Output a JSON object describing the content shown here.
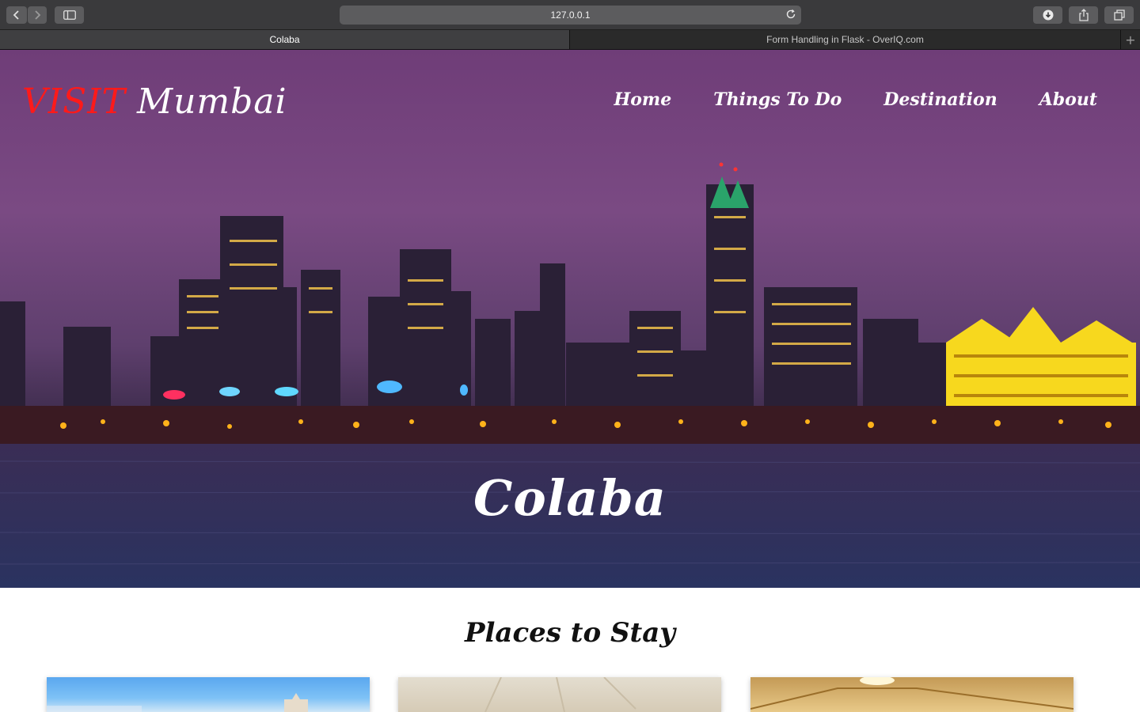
{
  "browser": {
    "url": "127.0.0.1",
    "tabs": [
      {
        "label": "Colaba",
        "active": true
      },
      {
        "label": "Form Handling in Flask - OverIQ.com",
        "active": false
      }
    ]
  },
  "site": {
    "brand_visit": "VISIT",
    "brand_city": "Mumbai",
    "nav": [
      "Home",
      "Things To Do",
      "Destination",
      "About"
    ],
    "hero_title": "Colaba",
    "section_title": "Places to Stay",
    "cards": [
      "hotel-photo-1",
      "hotel-photo-2",
      "hotel-photo-3"
    ]
  },
  "colors": {
    "brand_visit": "#ff1a1a",
    "chrome": "#3a3a3c"
  }
}
